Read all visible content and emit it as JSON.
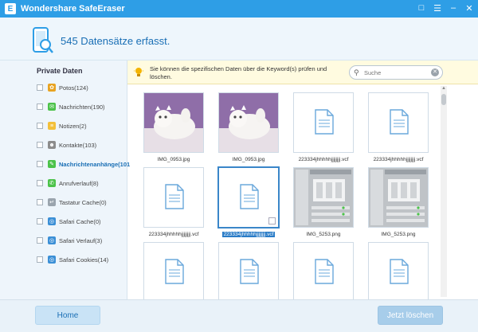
{
  "titlebar": {
    "logo_letter": "E",
    "title": "Wondershare SafeEraser"
  },
  "header": {
    "title": "545 Datensätze erfasst."
  },
  "sidebar": {
    "title": "Private Daten",
    "items": [
      {
        "label": "Potos(124)",
        "icon": "photos-icon",
        "color": "#e8a321"
      },
      {
        "label": "Nachrichten(190)",
        "icon": "messages-icon",
        "color": "#4cc24a"
      },
      {
        "label": "Notizen(2)",
        "icon": "notes-icon",
        "color": "#f3c03a"
      },
      {
        "label": "Kontakte(103)",
        "icon": "contacts-icon",
        "color": "#8c8c8c"
      },
      {
        "label": "Nachrichtenanhänge(101",
        "icon": "attachments-icon",
        "color": "#4cc24a",
        "active": true
      },
      {
        "label": "Anrufverlauf(8)",
        "icon": "call-log-icon",
        "color": "#4cc24a"
      },
      {
        "label": "Tastatur Cache(0)",
        "icon": "keyboard-icon",
        "color": "#9aa4ad"
      },
      {
        "label": "Safari Cache(0)",
        "icon": "safari-icon",
        "color": "#3b8fd6"
      },
      {
        "label": "Safari Verlauf(3)",
        "icon": "safari-icon",
        "color": "#3b8fd6"
      },
      {
        "label": "Safari Cookies(14)",
        "icon": "safari-icon",
        "color": "#3b8fd6"
      }
    ]
  },
  "infobar": {
    "text": "Sie können die spezifischen Daten über die Keyword(s) prüfen und löschen.",
    "search_placeholder": "Suche"
  },
  "files": [
    {
      "name": "IMG_0953.jpg",
      "kind": "photo"
    },
    {
      "name": "IMG_0953.jpg",
      "kind": "photo"
    },
    {
      "name": "223334jhhhhhjjjjjjjj.vcf",
      "kind": "doc"
    },
    {
      "name": "223334jhhhhhjjjjjjjj.vcf",
      "kind": "doc"
    },
    {
      "name": "223334jhhhhhjjjjjjjj.vcf",
      "kind": "doc"
    },
    {
      "name": "223334jhhhhhjjjjjjjj.vcf",
      "kind": "doc",
      "selected": true
    },
    {
      "name": "IMG_5253.png",
      "kind": "screenshot"
    },
    {
      "name": "IMG_5253.png",
      "kind": "screenshot"
    },
    {
      "name": "",
      "kind": "doc"
    },
    {
      "name": "",
      "kind": "doc"
    },
    {
      "name": "",
      "kind": "doc"
    },
    {
      "name": "",
      "kind": "doc"
    }
  ],
  "footer": {
    "home_label": "Home",
    "delete_label": "Jetzt löschen"
  },
  "colors": {
    "accent": "#2e9ee6",
    "selection": "#2a7cc7",
    "brand_text": "#1a6fb5"
  }
}
